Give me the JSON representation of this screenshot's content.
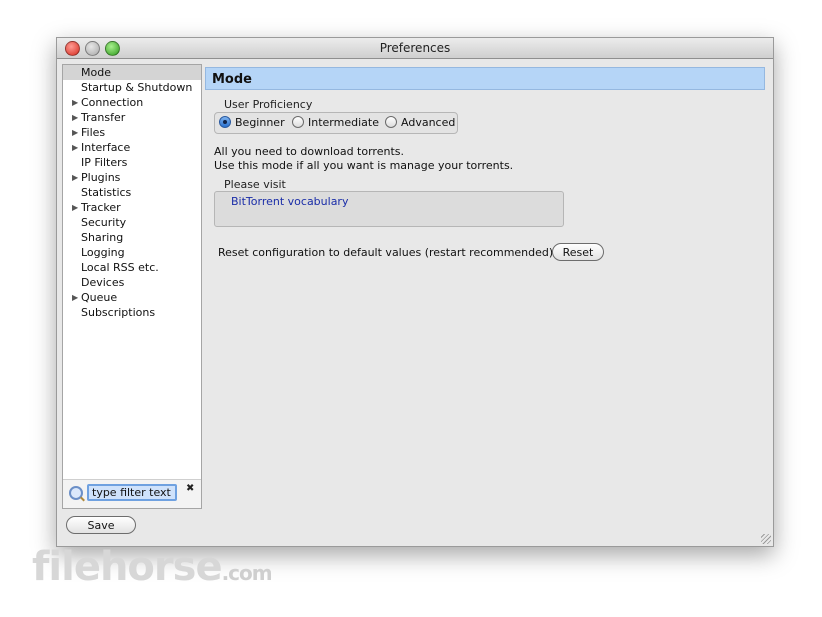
{
  "window": {
    "title": "Preferences"
  },
  "sidebar": {
    "items": [
      {
        "label": "Mode",
        "expandable": false,
        "selected": true
      },
      {
        "label": "Startup & Shutdown",
        "expandable": false
      },
      {
        "label": "Connection",
        "expandable": true
      },
      {
        "label": "Transfer",
        "expandable": true
      },
      {
        "label": "Files",
        "expandable": true
      },
      {
        "label": "Interface",
        "expandable": true
      },
      {
        "label": "IP Filters",
        "expandable": false
      },
      {
        "label": "Plugins",
        "expandable": true
      },
      {
        "label": "Statistics",
        "expandable": false
      },
      {
        "label": "Tracker",
        "expandable": true
      },
      {
        "label": "Security",
        "expandable": false
      },
      {
        "label": "Sharing",
        "expandable": false
      },
      {
        "label": "Logging",
        "expandable": false
      },
      {
        "label": "Local RSS etc.",
        "expandable": false
      },
      {
        "label": "Devices",
        "expandable": false
      },
      {
        "label": "Queue",
        "expandable": true
      },
      {
        "label": "Subscriptions",
        "expandable": false
      }
    ],
    "filter": {
      "value": "type filter text"
    }
  },
  "main": {
    "header": "Mode",
    "proficiency": {
      "legend": "User Proficiency",
      "options": [
        "Beginner",
        "Intermediate",
        "Advanced"
      ],
      "selected": "Beginner"
    },
    "description_lines": [
      "All you need to download torrents.",
      "Use this mode if all you want is manage your torrents."
    ],
    "visit": {
      "legend": "Please visit",
      "link": "BitTorrent vocabulary"
    },
    "reset": {
      "text": "Reset configuration to default values (restart recommended)",
      "button": "Reset"
    }
  },
  "footer": {
    "save_label": "Save"
  },
  "watermark": {
    "main": "filehorse",
    "suffix": ".com"
  },
  "colors": {
    "header_bg": "#b5d5f7",
    "link": "#1a2da8",
    "selected_item": "#d4d4d4"
  }
}
